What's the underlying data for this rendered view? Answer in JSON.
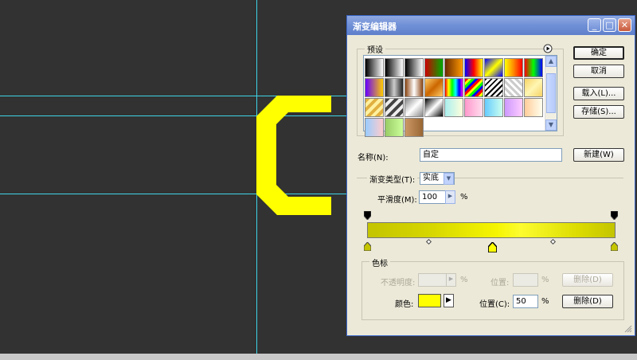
{
  "dialog": {
    "title": "渐变编辑器",
    "window_controls": {
      "minimize": "_",
      "maximize": "□",
      "close": "✕"
    }
  },
  "buttons": {
    "ok": "确定",
    "cancel": "取消",
    "load": "载入(L)...",
    "save": "存储(S)...",
    "new": "新建(W)",
    "delete_disabled": "删除(D)",
    "delete": "删除(D)"
  },
  "presets": {
    "label": "预设",
    "menu_icon": "arrow-circle-icon",
    "swatches": [
      "linear-gradient(90deg,#000,#fff)",
      "linear-gradient(90deg,#000,transparent)",
      "linear-gradient(90deg,#000,#fff)",
      "linear-gradient(90deg,#c00,#0a0)",
      "linear-gradient(90deg,#6a2a00,#f90)",
      "linear-gradient(90deg,#00f,#f00,#ff0)",
      "linear-gradient(135deg,#00f,#ff0,#00f)",
      "linear-gradient(90deg,#ff0,#f80,#f00)",
      "linear-gradient(90deg,#f00,#0f0,#00f)",
      "linear-gradient(90deg,#60f,#fc0)",
      "linear-gradient(90deg,#222,#ccc,#222)",
      "linear-gradient(90deg,#8b4513,#fff,#8b4513)",
      "linear-gradient(135deg,#ffcc66,#cc6600,#ffcc66)",
      "linear-gradient(90deg,#f00,#ff0,#0f0,#0ff,#00f,#f0f)",
      "repeating-linear-gradient(135deg,#f00 0 3px,#ff0 3px 6px,#0f0 6px 9px,#00f 9px 12px)",
      "repeating-linear-gradient(135deg,#000 0 2px,#fff 2px 5px)",
      "repeating-linear-gradient(45deg,#ccc 0 3px,#fff 3px 6px)",
      "linear-gradient(135deg,#f6d365,#fff6b3,#f6d365)",
      "repeating-linear-gradient(135deg,#e0b040 0 4px,#fff0a0 4px 8px)",
      "repeating-linear-gradient(135deg,#444 0 4px,#eee 4px 8px)",
      "linear-gradient(135deg,#888,#fff,#888)",
      "linear-gradient(135deg,#000,#fff,#000)",
      "linear-gradient(90deg,#aee,#ffd)",
      "linear-gradient(90deg,#f9c,#fde)",
      "linear-gradient(90deg,#6cf,#cfe)",
      "linear-gradient(90deg,#c9f,#fcf)",
      "linear-gradient(90deg,#fc9,#ffe)",
      "linear-gradient(90deg,#9cf,#fcc)",
      "linear-gradient(90deg,#9c6,#cf9)",
      "linear-gradient(90deg,#c96,#963)"
    ]
  },
  "name_field": {
    "label": "名称(N):",
    "value": "自定"
  },
  "gradient_type": {
    "label": "渐变类型(T):",
    "value": "实底"
  },
  "smoothness": {
    "label": "平滑度(M):",
    "value": "100",
    "unit": "%"
  },
  "gradient": {
    "left_color": "#c4c400",
    "mid_color": "#ffff00",
    "right_color": "#c4c400"
  },
  "color_stops_group": {
    "title": "色标",
    "opacity_label": "不透明度:",
    "opacity_unit": "%",
    "location_label_top": "位置:",
    "location_unit_top": "%",
    "color_label": "颜色:",
    "location_label": "位置(C):",
    "location_value": "50",
    "location_unit": "%",
    "selected_color": "#ffff00"
  }
}
